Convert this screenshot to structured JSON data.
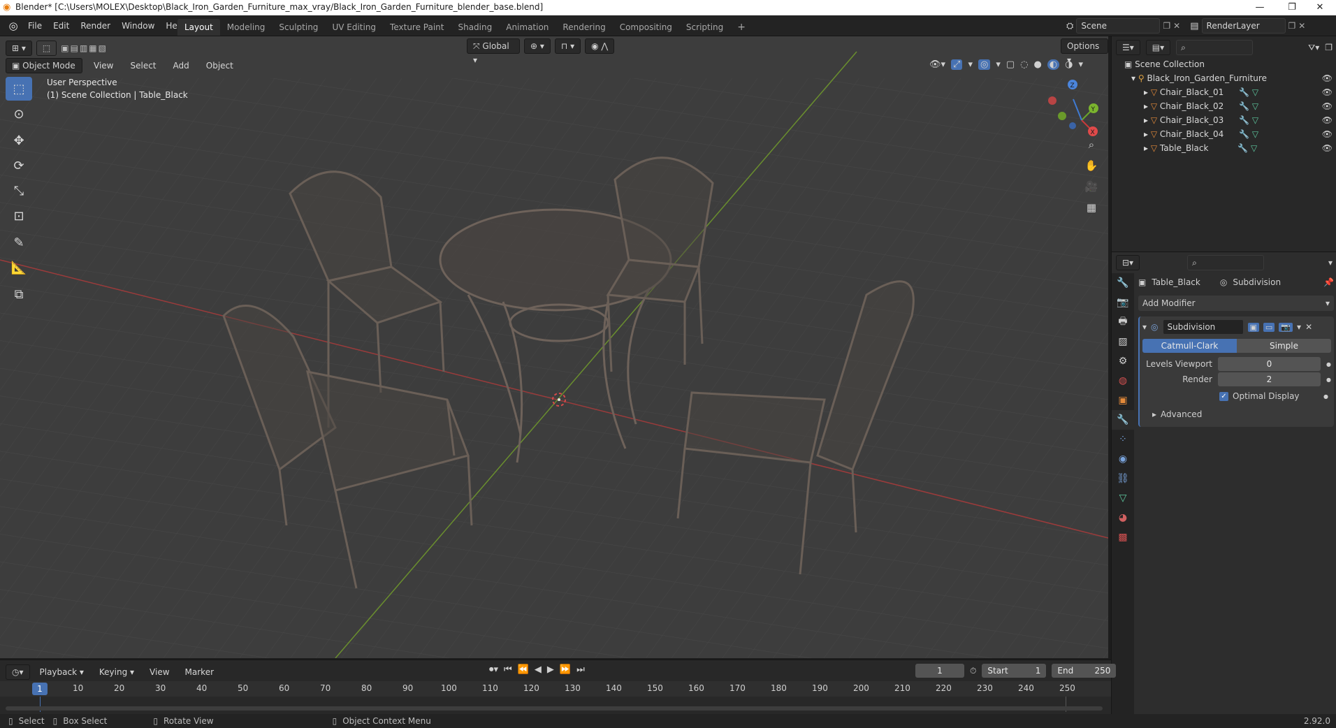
{
  "window": {
    "title": "Blender* [C:\\Users\\MOLEX\\Desktop\\Black_Iron_Garden_Furniture_max_vray/Black_Iron_Garden_Furniture_blender_base.blend]"
  },
  "menu": [
    "File",
    "Edit",
    "Render",
    "Window",
    "Help"
  ],
  "workspaces": [
    "Layout",
    "Modeling",
    "Sculpting",
    "UV Editing",
    "Texture Paint",
    "Shading",
    "Animation",
    "Rendering",
    "Compositing",
    "Scripting"
  ],
  "active_workspace": "Layout",
  "scene": {
    "name": "Scene",
    "render_layer": "RenderLayer"
  },
  "viewport": {
    "mode": "Object Mode",
    "menus": [
      "View",
      "Select",
      "Add",
      "Object"
    ],
    "transform_orientation": "Global",
    "options_label": "Options",
    "perspective_label": "User Perspective",
    "collection_label": "(1) Scene Collection | Table_Black"
  },
  "outliner": {
    "root": "Scene Collection",
    "collection": "Black_Iron_Garden_Furniture",
    "objects": [
      "Chair_Black_01",
      "Chair_Black_02",
      "Chair_Black_03",
      "Chair_Black_04",
      "Table_Black"
    ]
  },
  "properties": {
    "object_name": "Table_Black",
    "modifier_breadcrumb": "Subdivision",
    "add_modifier_label": "Add Modifier",
    "modifier_name": "Subdivision",
    "mode_catmull": "Catmull-Clark",
    "mode_simple": "Simple",
    "levels_viewport_label": "Levels Viewport",
    "levels_viewport_value": "0",
    "render_label": "Render",
    "render_value": "2",
    "optimal_display_label": "Optimal Display",
    "advanced_label": "Advanced"
  },
  "timeline": {
    "menus": [
      "Playback",
      "Keying",
      "View",
      "Marker"
    ],
    "current_frame": "1",
    "start_label": "Start",
    "start_value": "1",
    "end_label": "End",
    "end_value": "250",
    "ruler": [
      "10",
      "20",
      "30",
      "40",
      "50",
      "60",
      "70",
      "80",
      "90",
      "100",
      "110",
      "120",
      "130",
      "140",
      "150",
      "160",
      "170",
      "180",
      "190",
      "200",
      "210",
      "220",
      "230",
      "240",
      "250"
    ],
    "playhead": "1"
  },
  "statusbar": {
    "select": "Select",
    "box_select": "Box Select",
    "rotate_view": "Rotate View",
    "context_menu": "Object Context Menu",
    "version": "2.92.0"
  }
}
